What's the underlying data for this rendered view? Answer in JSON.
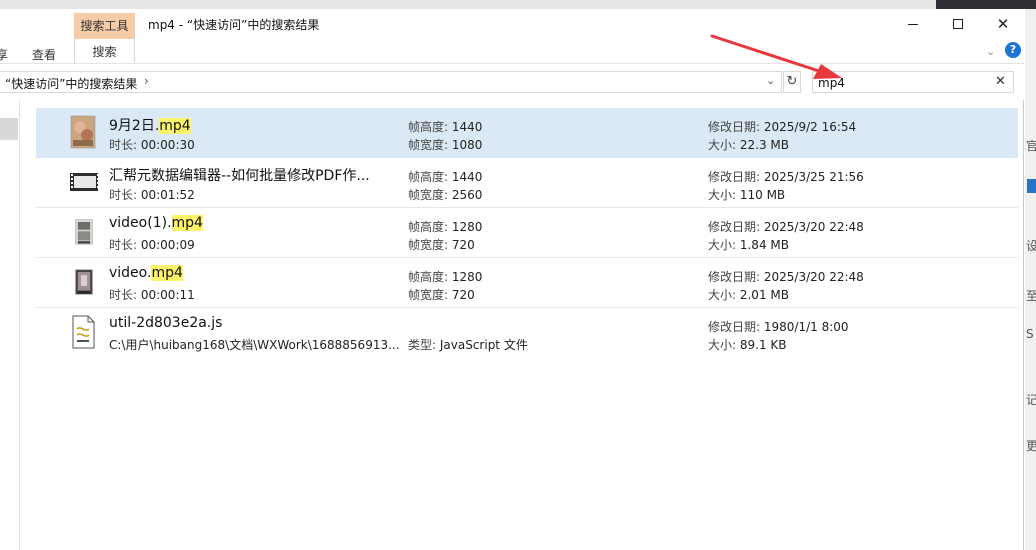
{
  "window": {
    "title": "mp4 - “快速访问”中的搜索结果",
    "context_tab": "搜索工具",
    "tabs": [
      "享",
      "查看",
      "搜索"
    ]
  },
  "address": {
    "path": "“快速访问”中的搜索结果",
    "chevron": "›"
  },
  "search": {
    "value": "mp4",
    "clear": "✕"
  },
  "controls": {
    "refresh": "↻",
    "dropdown": "⌄",
    "ribbon_expand": "⌄",
    "help": "?",
    "close": "✕"
  },
  "results": [
    {
      "name_pre": "9月2日.",
      "name_hl": "mp4",
      "name_post": "",
      "sub_label": "时长: ",
      "sub_value": "00:00:30",
      "m1_label": "帧高度: ",
      "m1_value": "1440",
      "m2_label": "帧宽度: ",
      "m2_value": "1080",
      "r1_label": "修改日期: ",
      "r1_value": "2025/9/2 16:54",
      "r2_label": "大小: ",
      "r2_value": "22.3 MB"
    },
    {
      "name_pre": "汇帮元数据编辑器--如何批量修改PDF作...",
      "name_hl": "",
      "name_post": "",
      "sub_label": "时长: ",
      "sub_value": "00:01:52",
      "m1_label": "帧高度: ",
      "m1_value": "1440",
      "m2_label": "帧宽度: ",
      "m2_value": "2560",
      "r1_label": "修改日期: ",
      "r1_value": "2025/3/25 21:56",
      "r2_label": "大小: ",
      "r2_value": "110 MB"
    },
    {
      "name_pre": "video(1).",
      "name_hl": "mp4",
      "name_post": "",
      "sub_label": "时长: ",
      "sub_value": "00:00:09",
      "m1_label": "帧高度: ",
      "m1_value": "1280",
      "m2_label": "帧宽度: ",
      "m2_value": "720",
      "r1_label": "修改日期: ",
      "r1_value": "2025/3/20 22:48",
      "r2_label": "大小: ",
      "r2_value": "1.84 MB"
    },
    {
      "name_pre": "video.",
      "name_hl": "mp4",
      "name_post": "",
      "sub_label": "时长: ",
      "sub_value": "00:00:11",
      "m1_label": "帧高度: ",
      "m1_value": "1280",
      "m2_label": "帧宽度: ",
      "m2_value": "720",
      "r1_label": "修改日期: ",
      "r1_value": "2025/3/20 22:48",
      "r2_label": "大小: ",
      "r2_value": "2.01 MB"
    },
    {
      "name_pre": "util-2d803e2a.js",
      "name_hl": "",
      "name_post": "",
      "sub_label": "",
      "sub_value": "C:\\用户\\huibang168\\文档\\WXWork\\1688856913...",
      "m1_label": "",
      "m1_value": "",
      "m2_label": "类型: ",
      "m2_value": "JavaScript 文件",
      "r1_label": "修改日期: ",
      "r1_value": "1980/1/1 8:00",
      "r2_label": "大小: ",
      "r2_value": "89.1 KB"
    }
  ],
  "right_edge_chars": [
    "官",
    "设",
    "至",
    "S",
    "记",
    "更"
  ],
  "colors": {
    "selection": "#dbe9f7",
    "highlight": "#fff36a",
    "context_tab": "#f6cba8",
    "arrow": "#e8383d"
  }
}
